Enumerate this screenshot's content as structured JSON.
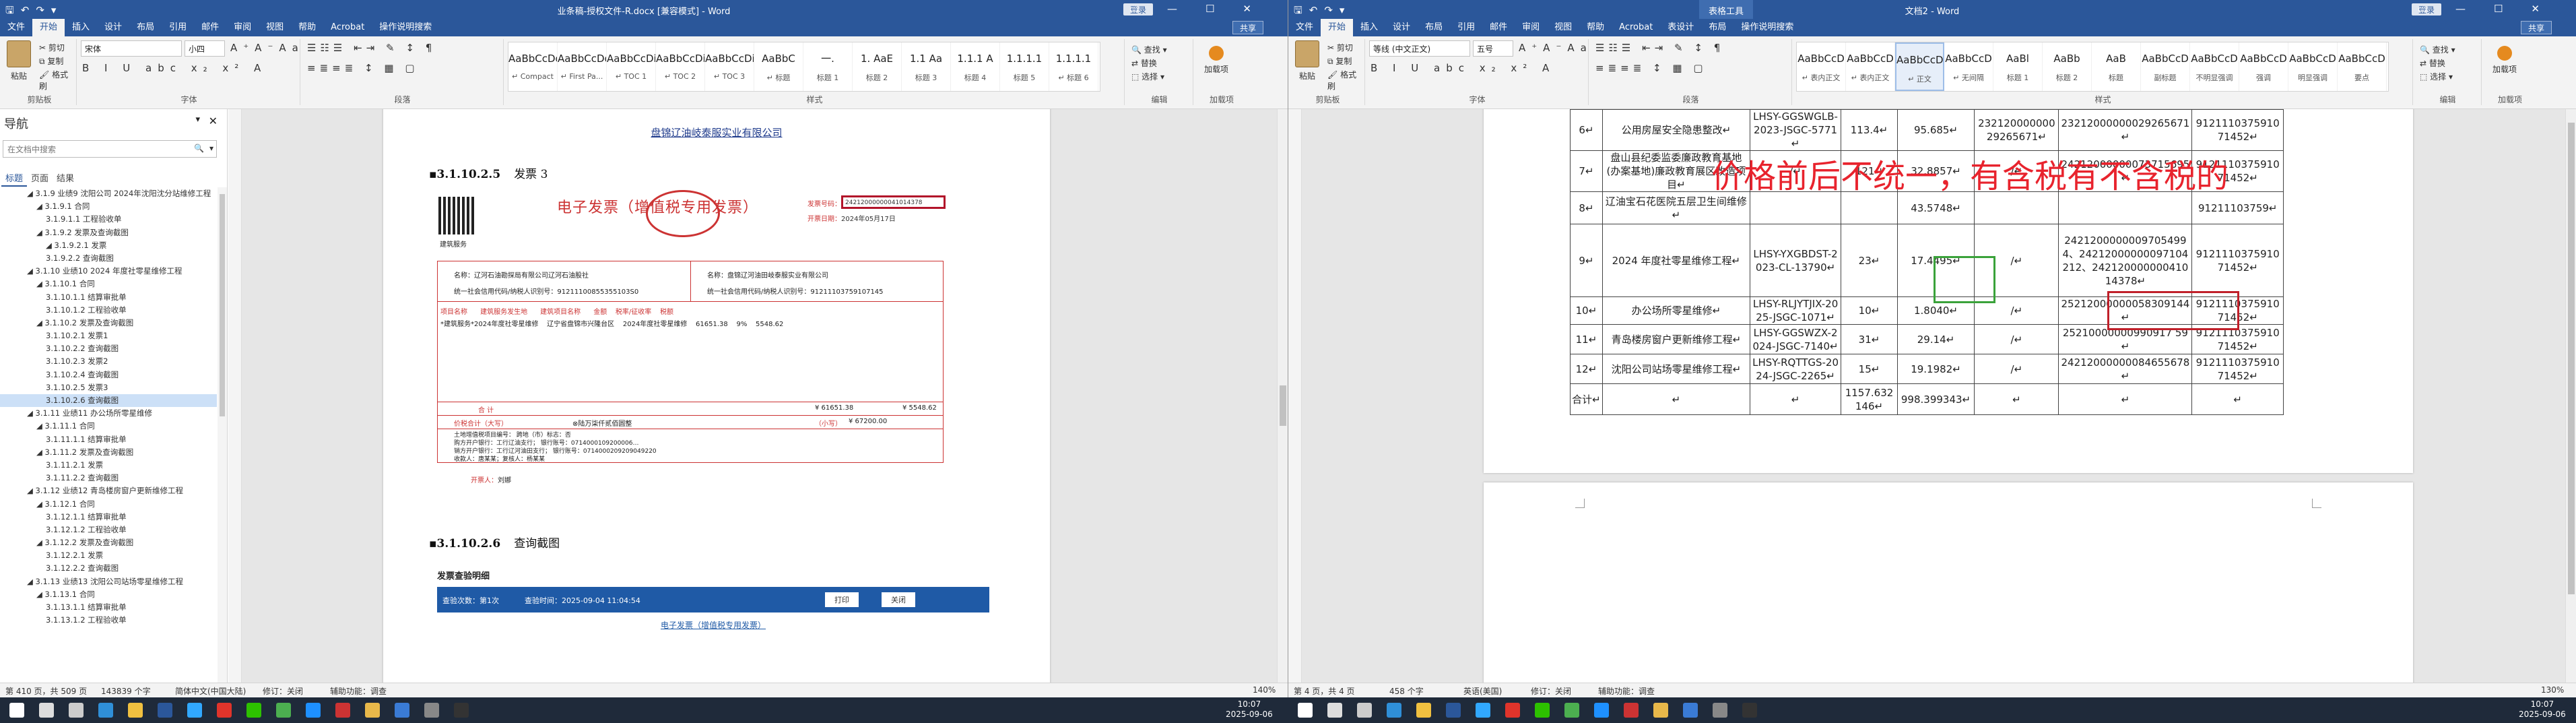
{
  "left_window": {
    "title": "业条稿-授权文件-R.docx [兼容模式] - Word",
    "user": "登录",
    "tabs": [
      "文件",
      "开始",
      "插入",
      "设计",
      "布局",
      "引用",
      "邮件",
      "审阅",
      "视图",
      "帮助",
      "Acrobat",
      "操作说明搜索"
    ],
    "share": "共享",
    "clipboard": {
      "paste": "粘贴",
      "cut": "剪切",
      "copy": "复制",
      "painter": "格式刷",
      "label": "剪贴板"
    },
    "font": {
      "name": "宋体",
      "size": "小四",
      "label": "字体",
      "buttons": "B I U abc x₂ x² A"
    },
    "paragraph_label": "段落",
    "styles_label": "样式",
    "styles": [
      {
        "preview": "AaBbCcDd",
        "name": "↵ Compact"
      },
      {
        "preview": "AaBbCcDd",
        "name": "↵ First Pa..."
      },
      {
        "preview": "AaBbCcDi",
        "name": "↵ TOC 1"
      },
      {
        "preview": "AaBbCcDi",
        "name": "↵ TOC 2"
      },
      {
        "preview": "AaBbCcDi",
        "name": "↵ TOC 3"
      },
      {
        "preview": "AaBbC",
        "name": "↵ 标题"
      },
      {
        "preview": "一.",
        "name": "标题 1"
      },
      {
        "preview": "1. AaE",
        "name": "标题 2"
      },
      {
        "preview": "1.1 Aa",
        "name": "标题 3"
      },
      {
        "preview": "1.1.1 A",
        "name": "标题 4"
      },
      {
        "preview": "1.1.1.1",
        "name": "标题 5"
      },
      {
        "preview": "1.1.1.1",
        "name": "↵ 标题 6"
      }
    ],
    "editing": {
      "find": "查找",
      "replace": "替换",
      "select": "选择",
      "label": "编辑"
    },
    "addin": {
      "name": "加载项",
      "label": "加载项"
    },
    "nav": {
      "title": "导航",
      "search_placeholder": "在文档中搜索",
      "tabs": [
        "标题",
        "页面",
        "结果"
      ],
      "items": [
        {
          "text": "◢ 3.1.9 业绩9 沈阳公司 2024年沈阳沈分站维修工程",
          "level": 1
        },
        {
          "text": "◢ 3.1.9.1 合同",
          "level": 2
        },
        {
          "text": "3.1.9.1.1 工程验收单",
          "level": 3
        },
        {
          "text": "◢ 3.1.9.2 发票及查询截图",
          "level": 2
        },
        {
          "text": "◢ 3.1.9.2.1 发票",
          "level": 3
        },
        {
          "text": "3.1.9.2.2 查询截图",
          "level": 3
        },
        {
          "text": "◢ 3.1.10 业绩10 2024 年度社零星维修工程",
          "level": 1
        },
        {
          "text": "◢ 3.1.10.1 合同",
          "level": 2
        },
        {
          "text": "3.1.10.1.1 结算审批单",
          "level": 3
        },
        {
          "text": "3.1.10.1.2 工程验收单",
          "level": 3
        },
        {
          "text": "◢ 3.1.10.2 发票及查询截图",
          "level": 2
        },
        {
          "text": "3.1.10.2.1 发票1",
          "level": 3
        },
        {
          "text": "3.1.10.2.2 查询截图",
          "level": 3
        },
        {
          "text": "3.1.10.2.3 发票2",
          "level": 3
        },
        {
          "text": "3.1.10.2.4 查询截图",
          "level": 3
        },
        {
          "text": "3.1.10.2.5 发票3",
          "level": 3
        },
        {
          "text": "3.1.10.2.6 查询截图",
          "level": 3,
          "selected": true
        },
        {
          "text": "◢ 3.1.11 业绩11 办公场所零星维修",
          "level": 1
        },
        {
          "text": "◢ 3.1.11.1 合同",
          "level": 2
        },
        {
          "text": "3.1.11.1.1 结算审批单",
          "level": 3
        },
        {
          "text": "◢ 3.1.11.2 发票及查询截图",
          "level": 2
        },
        {
          "text": "3.1.11.2.1 发票",
          "level": 3
        },
        {
          "text": "3.1.11.2.2 查询截图",
          "level": 3
        },
        {
          "text": "◢ 3.1.12 业绩12 青岛楼房窗户更新维修工程",
          "level": 1
        },
        {
          "text": "◢ 3.1.12.1 合同",
          "level": 2
        },
        {
          "text": "3.1.12.1.1 结算审批单",
          "level": 3
        },
        {
          "text": "3.1.12.1.2 工程验收单",
          "level": 3
        },
        {
          "text": "◢ 3.1.12.2 发票及查询截图",
          "level": 2
        },
        {
          "text": "3.1.12.2.1 发票",
          "level": 3
        },
        {
          "text": "3.1.12.2.2 查询截图",
          "level": 3
        },
        {
          "text": "◢ 3.1.13 业绩13 沈阳公司站场零星维修工程",
          "level": 1
        },
        {
          "text": "◢ 3.1.13.1 合同",
          "level": 2
        },
        {
          "text": "3.1.13.1.1 结算审批单",
          "level": 3
        },
        {
          "text": "3.1.13.1.2 工程验收单",
          "level": 3
        }
      ]
    },
    "doc": {
      "header": "盘锦辽油岐泰服实业有限公司",
      "heading1_num": "3.1.10.2.5",
      "heading1_text": "发票 3",
      "invoice_title": "电子发票（增值税专用发票）",
      "invoice_no_label": "发票号码：",
      "invoice_no": "24212000000041014378",
      "invoice_date_label": "开票日期：",
      "invoice_date": "2024年05月17日",
      "service": "建筑服务",
      "buyer": "名称：辽河石油勘探局有限公司辽河石油股社",
      "buyer_tax": "统一社会信用代码/纳税人识别号：91211100855355103S0",
      "seller": "名称：盘锦辽河油田岐泰服实业有限公司",
      "seller_tax": "统一社会信用代码/纳税人识别号：91211103759107145",
      "col_headers": "项目名称      建筑服务发生地      建筑项目名称      金额    税率/征收率    税额",
      "row1": "*建筑服务*2024年度社零星维修    辽宁省盘锦市兴隆台区    2024年度社零星维修    61651.38    9%    5548.62",
      "total_label": "合  计",
      "total_amount": "¥ 61651.38",
      "total_tax": "¥ 5548.62",
      "words_label": "价税合计（大写）",
      "words": "⊗陆万柒仟贰佰圆整",
      "small_label": "（小写）",
      "small": "¥ 67200.00",
      "note1": "土地增值税项目编号：     跨地（市）标志：否",
      "note2": "购方开户银行：工行辽油支行；  银行账号：0714000109200006…",
      "note3": "销方开户银行：工行辽河油田支行；  银行账号：0714000209209049220",
      "note4": "收款人：唐某某；复核人：杨某某",
      "issuer_label": "开票人：",
      "issuer": "刘娜",
      "heading2_num": "3.1.10.2.6",
      "heading2_text": "查询截图",
      "query_title": "发票查验明细",
      "query_count": "查验次数：第1次",
      "query_time": "查验时间：2025-09-04 11:04:54",
      "print": "打印",
      "close": "关闭",
      "query_sub": "电子发票（增值税专用发票）"
    },
    "status": {
      "page": "第 410 页，共 509 页",
      "words": "143839 个字",
      "lang": "简体中文(中国大陆)",
      "track": "修订：关闭",
      "access": "辅助功能：调查",
      "zoom": "140%"
    }
  },
  "right_window": {
    "title": "文档2 - Word",
    "context_tab": "表格工具",
    "user": "登录",
    "tabs": [
      "文件",
      "开始",
      "插入",
      "设计",
      "布局",
      "引用",
      "邮件",
      "审阅",
      "视图",
      "帮助",
      "Acrobat",
      "表设计",
      "布局",
      "操作说明搜索"
    ],
    "share": "共享",
    "clipboard": {
      "paste": "粘贴",
      "cut": "剪切",
      "copy": "复制",
      "painter": "格式刷",
      "label": "剪贴板"
    },
    "font": {
      "name": "等线 (中文正文)",
      "size": "五号",
      "label": "字体",
      "buttons": "B I U abc x₂ x² A"
    },
    "paragraph_label": "段落",
    "styles_label": "样式",
    "styles": [
      {
        "preview": "AaBbCcD",
        "name": "↵ 表内正文"
      },
      {
        "preview": "AaBbCcD",
        "name": "↵ 表内正文"
      },
      {
        "preview": "AaBbCcD",
        "name": "↵ 正文",
        "selected": true
      },
      {
        "preview": "AaBbCcD",
        "name": "↵ 无间隔"
      },
      {
        "preview": "AaBl",
        "name": "标题 1"
      },
      {
        "preview": "AaBb",
        "name": "标题 2"
      },
      {
        "preview": "AaB",
        "name": "标题"
      },
      {
        "preview": "AaBbCcD",
        "name": "副标题"
      },
      {
        "preview": "AaBbCcD",
        "name": "不明显强调"
      },
      {
        "preview": "AaBbCcD",
        "name": "强调"
      },
      {
        "preview": "AaBbCcD",
        "name": "明显强调"
      },
      {
        "preview": "AaBbCcD",
        "name": "要点"
      }
    ],
    "editing": {
      "find": "查找",
      "replace": "替换",
      "select": "选择",
      "label": "编辑"
    },
    "addin": {
      "name": "加载项",
      "label": "加载项"
    },
    "table_rows": [
      {
        "no": "6↵",
        "name": "公用房屋安全隐患整改↵",
        "code": "LHSY-GGSWGLB-2023-JSGC-5771↵",
        "amount": "113.4↵",
        "tax": "95.685↵",
        "inv1": "23212000000029265671↵",
        "inv2": "23212000000029265671↵",
        "credit": "912111037591071452↵"
      },
      {
        "no": "7↵",
        "name": "盘山县纪委监委廉政教育基地(办案基地)廉政教育展区改造项目↵",
        "code": "/↵",
        "amount": "121↵",
        "tax": "32.8857↵",
        "inv1": "/↵",
        "inv2": "24212000000073715695↵",
        "credit": "912111037591071452↵"
      },
      {
        "no": "8↵",
        "name": "辽油宝石花医院五层卫生间维修↵",
        "code": "",
        "amount": "",
        "tax": "43.5748↵",
        "inv1": "",
        "inv2": "",
        "credit": "91211103759↵"
      },
      {
        "no": "9↵",
        "name": "2024 年度社零星维修工程↵",
        "code": "LHSY-YXGBDST-2023-CL-13790↵",
        "amount": "23↵",
        "tax": "17.4495↵",
        "inv1": "/↵",
        "inv2": "24212000000097054994、24212000000097104212、24212000000041014378↵",
        "credit": "912111037591071452↵"
      },
      {
        "no": "10↵",
        "name": "办公场所零星维修↵",
        "code": "LHSY-RLJYTJIX-2025-JSGC-1071↵",
        "amount": "10↵",
        "tax": "1.8040↵",
        "inv1": "/↵",
        "inv2": "25212000000058309144↵",
        "credit": "912111037591071452↵"
      },
      {
        "no": "11↵",
        "name": "青岛楼房窗户更新维修工程↵",
        "code": "LHSY-GGSWZX-2024-JSGC-7140↵",
        "amount": "31↵",
        "tax": "29.14↵",
        "inv1": "/↵",
        "inv2": "25210000000990917 59↵",
        "credit": "912111037591071452↵"
      },
      {
        "no": "12↵",
        "name": "沈阳公司站场零星维修工程↵",
        "code": "LHSY-RQTTGS-2024-JSGC-2265↵",
        "amount": "15↵",
        "tax": "19.1982↵",
        "inv1": "/↵",
        "inv2": "24212000000084655678↵",
        "credit": "912111037591071452↵"
      },
      {
        "no": "合计↵",
        "name": "↵",
        "code": "↵",
        "amount": "1157.632146↵",
        "tax": "998.399343↵",
        "inv1": "↵",
        "inv2": "↵",
        "credit": "↵"
      }
    ],
    "annotation": "价格前后不统一，有含税有不含税的",
    "status": {
      "page": "第 4 页，共 4 页",
      "words": "458 个字",
      "lang": "英语(美国)",
      "track": "修订：关闭",
      "access": "辅助功能：调查",
      "zoom": "130%"
    }
  },
  "taskbar": {
    "left_time": "10:07",
    "left_date": "2025-09-06",
    "right_time": "10:07",
    "right_date": "2025-09-06",
    "icons": [
      "start-icon",
      "search-icon",
      "task-view-icon",
      "edge-icon",
      "explorer-icon",
      "word-icon",
      "photoshop-icon",
      "acrobat-icon",
      "wechat-icon",
      "chrome-icon",
      "qq-icon",
      "wps-icon",
      "folder-icon",
      "mail-icon",
      "settings-icon",
      "terminal-icon"
    ]
  }
}
